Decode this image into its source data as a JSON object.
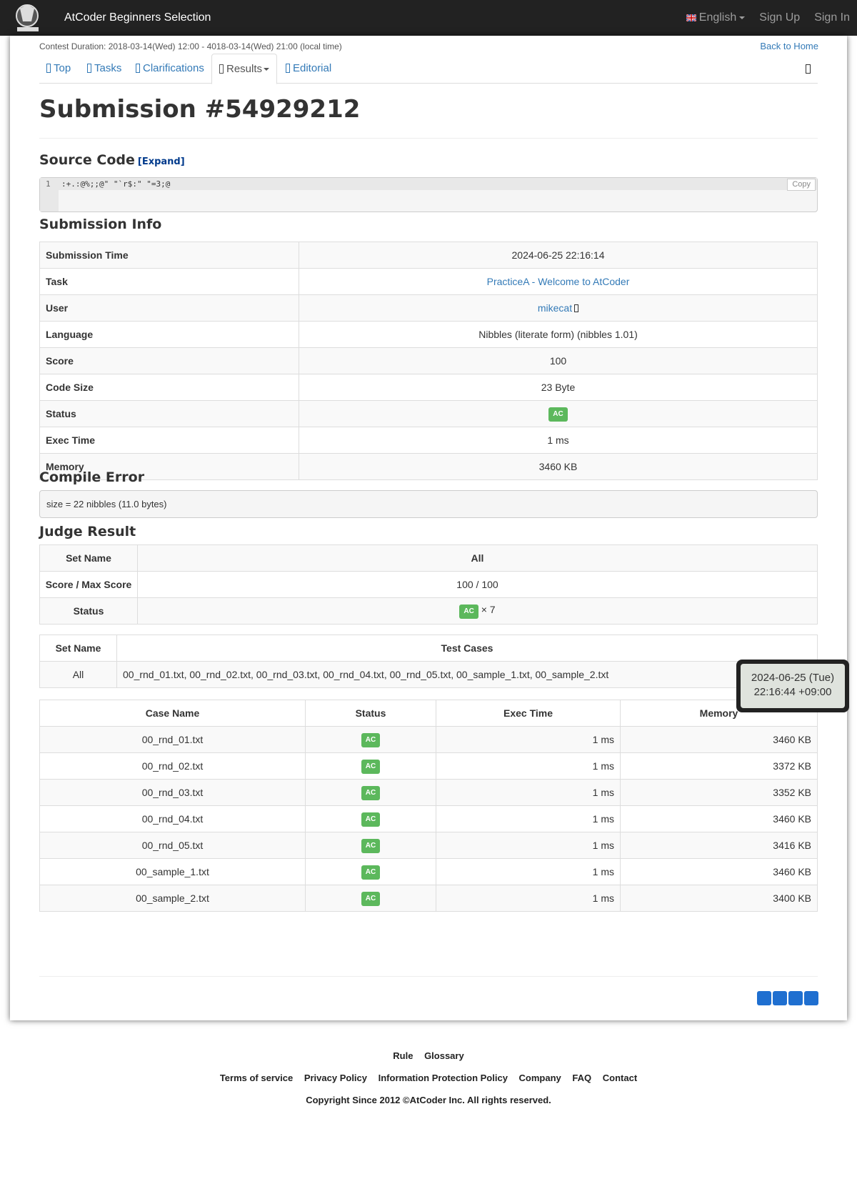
{
  "navbar": {
    "brand": "AtCoder Beginners Selection",
    "language": "English",
    "sign_up": "Sign Up",
    "sign_in": "Sign In"
  },
  "contest": {
    "duration": "Contest Duration: 2018-03-14(Wed) 12:00 - 4018-03-14(Wed) 21:00 (local time)",
    "back_home": "Back to Home"
  },
  "tabs": [
    "Top",
    "Tasks",
    "Clarifications",
    "Results",
    "Editorial"
  ],
  "page_title": "Submission #54929212",
  "source": {
    "heading": "Source Code",
    "expand": "[Expand]",
    "line_no": "1",
    "code": ":+.:@%;;@\" \"`r$:\" \"=3;@",
    "copy": "Copy"
  },
  "info": {
    "heading": "Submission Info",
    "rows": [
      {
        "k": "Submission Time",
        "v": "2024-06-25 22:16:14"
      },
      {
        "k": "Task",
        "v": "PracticeA - Welcome to AtCoder"
      },
      {
        "k": "User",
        "v": "mikecat"
      },
      {
        "k": "Language",
        "v": "Nibbles (literate form) (nibbles 1.01)"
      },
      {
        "k": "Score",
        "v": "100"
      },
      {
        "k": "Code Size",
        "v": "23 Byte"
      },
      {
        "k": "Status",
        "v": "AC"
      },
      {
        "k": "Exec Time",
        "v": "1 ms"
      },
      {
        "k": "Memory",
        "v": "3460 KB"
      }
    ]
  },
  "compile_error": {
    "heading": "Compile Error",
    "text": "size = 22 nibbles (11.0 bytes)"
  },
  "judge": {
    "heading": "Judge Result",
    "set_name_label": "Set Name",
    "set_name": "All",
    "score_label": "Score / Max Score",
    "score": "100 / 100",
    "status_label": "Status",
    "status": "AC",
    "count": "× 7"
  },
  "sets": {
    "set_name_label": "Set Name",
    "test_cases_label": "Test Cases",
    "set_name": "All",
    "cases": "00_rnd_01.txt, 00_rnd_02.txt, 00_rnd_03.txt, 00_rnd_04.txt, 00_rnd_05.txt, 00_sample_1.txt, 00_sample_2.txt"
  },
  "tooltip": {
    "line1": "2024-06-25 (Tue)",
    "line2": "22:16:44 +09:00"
  },
  "cases": {
    "headers": [
      "Case Name",
      "Status",
      "Exec Time",
      "Memory"
    ],
    "rows": [
      {
        "name": "00_rnd_01.txt",
        "status": "AC",
        "time": "1 ms",
        "mem": "3460 KB"
      },
      {
        "name": "00_rnd_02.txt",
        "status": "AC",
        "time": "1 ms",
        "mem": "3372 KB"
      },
      {
        "name": "00_rnd_03.txt",
        "status": "AC",
        "time": "1 ms",
        "mem": "3352 KB"
      },
      {
        "name": "00_rnd_04.txt",
        "status": "AC",
        "time": "1 ms",
        "mem": "3460 KB"
      },
      {
        "name": "00_rnd_05.txt",
        "status": "AC",
        "time": "1 ms",
        "mem": "3416 KB"
      },
      {
        "name": "00_sample_1.txt",
        "status": "AC",
        "time": "1 ms",
        "mem": "3460 KB"
      },
      {
        "name": "00_sample_2.txt",
        "status": "AC",
        "time": "1 ms",
        "mem": "3400 KB"
      }
    ]
  },
  "footer": {
    "row1": [
      "Rule",
      "Glossary"
    ],
    "row2": [
      "Terms of service",
      "Privacy Policy",
      "Information Protection Policy",
      "Company",
      "FAQ",
      "Contact"
    ],
    "copyright": "Copyright Since 2012 ©AtCoder Inc. All rights reserved."
  },
  "colors": {
    "navbar": "#222222",
    "link": "#337ab7",
    "ac_badge": "#5cb85c"
  }
}
